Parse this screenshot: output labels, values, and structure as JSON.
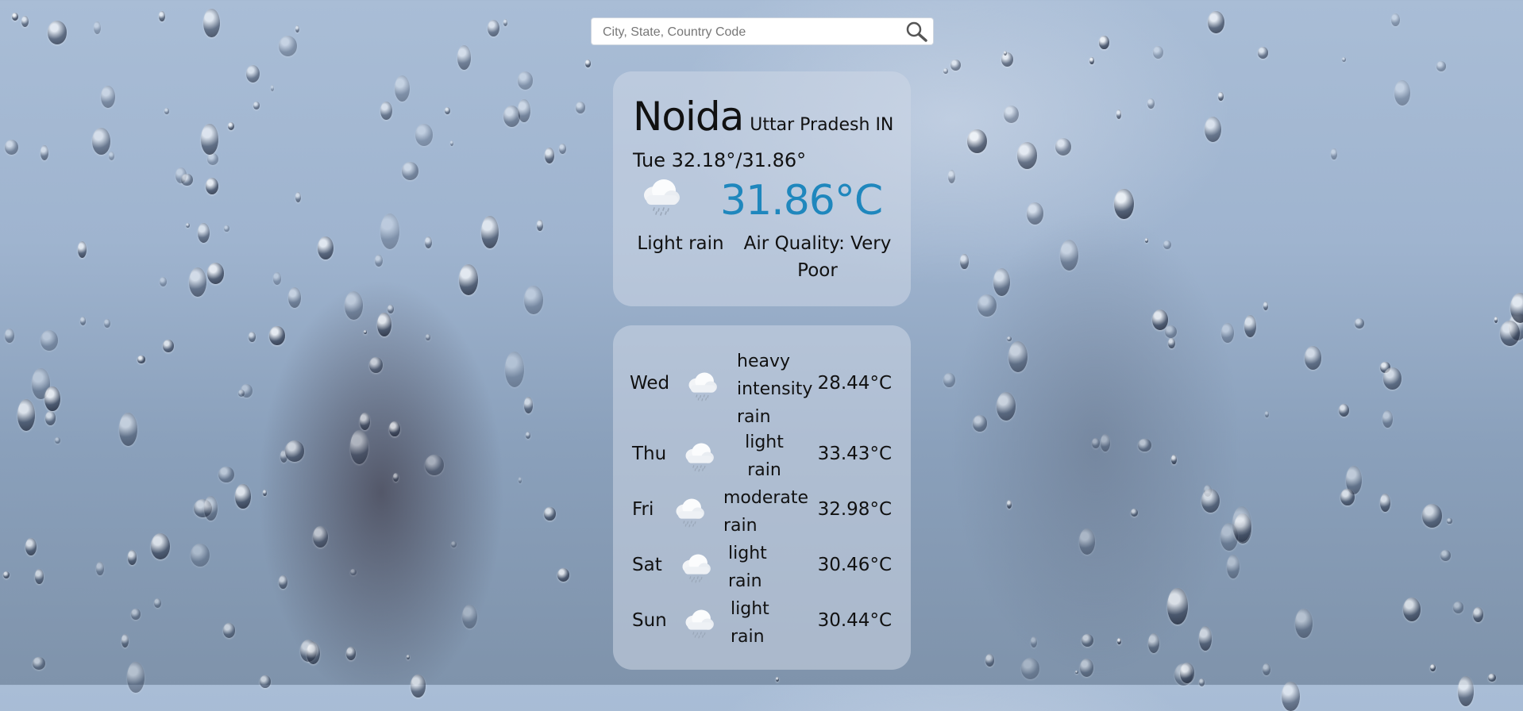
{
  "search": {
    "placeholder": "City, State, Country Code"
  },
  "current": {
    "city": "Noida",
    "region": "Uttar Pradesh IN",
    "today": "Tue 32.18°/31.86°",
    "temperature": "31.86°C",
    "description": "Light rain",
    "air_quality": "Air Quality: Very Poor",
    "icon": "rain-cloud-icon"
  },
  "forecast": [
    {
      "day": "Wed",
      "condition": "heavy intensity rain",
      "temp": "28.44°C",
      "icon": "rain-cloud-icon"
    },
    {
      "day": "Thu",
      "condition": "light rain",
      "temp": "33.43°C",
      "icon": "rain-cloud-icon"
    },
    {
      "day": "Fri",
      "condition": "moderate rain",
      "temp": "32.98°C",
      "icon": "rain-cloud-icon"
    },
    {
      "day": "Sat",
      "condition": "light rain",
      "temp": "30.46°C",
      "icon": "rain-cloud-icon"
    },
    {
      "day": "Sun",
      "condition": "light rain",
      "temp": "30.44°C",
      "icon": "rain-cloud-icon"
    }
  ],
  "colors": {
    "temperature": "#1f87bd"
  }
}
